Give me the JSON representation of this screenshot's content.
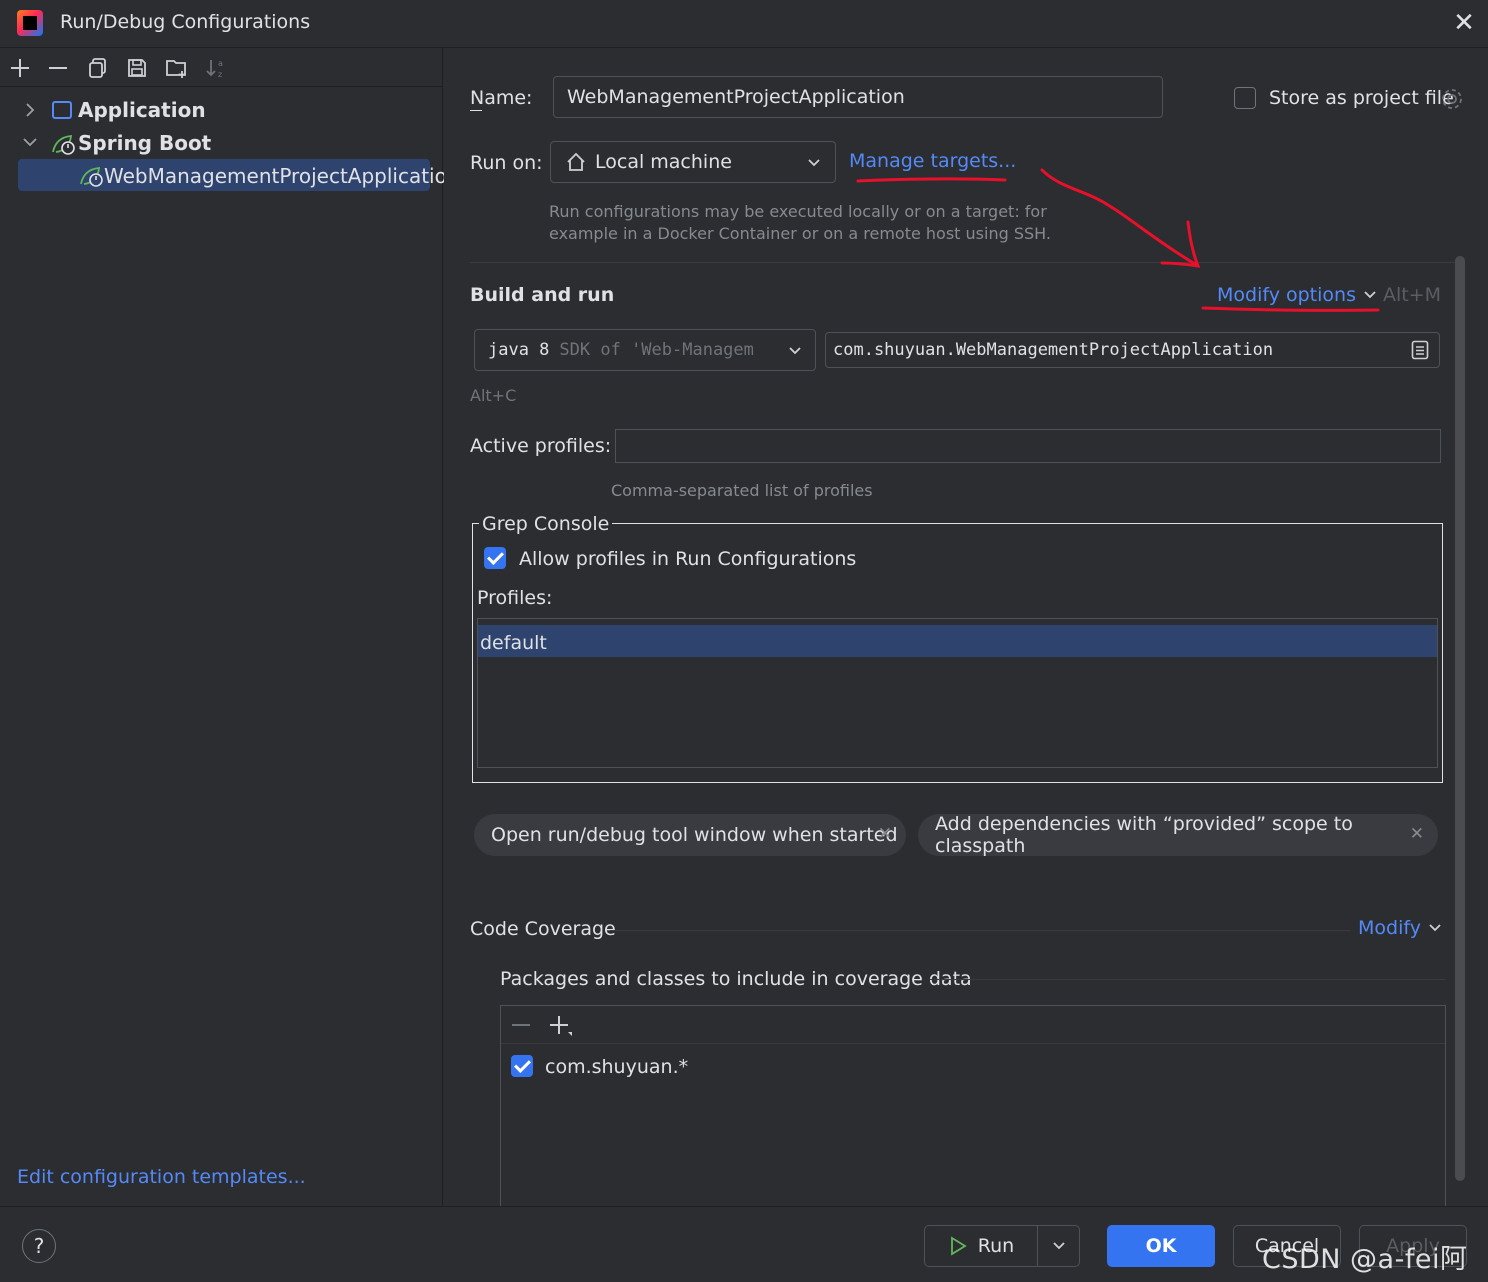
{
  "window": {
    "title": "Run/Debug Configurations",
    "close": "✕"
  },
  "toolbar": {
    "add": "+",
    "remove": "—",
    "copy": "⧉",
    "save": "💾",
    "folder": "📁",
    "sort": "↓ᵃᶻ"
  },
  "tree": {
    "application": "Application",
    "spring_boot": "Spring Boot",
    "selected": "WebManagementProjectApplication"
  },
  "edit_templates": "Edit configuration templates...",
  "form": {
    "name_label": "Name:",
    "name_value": "WebManagementProjectApplication",
    "store_label": "Store as project file",
    "run_on_label": "Run on:",
    "run_on_value": "Local machine",
    "manage_targets": "Manage targets...",
    "run_on_hint_1": "Run configurations may be executed locally or on a target: for",
    "run_on_hint_2": "example in a Docker Container or on a remote host using SSH.",
    "build_run": "Build and run",
    "modify_options": "Modify options",
    "modify_shortcut": "Alt+M",
    "sdk_java": "java 8",
    "sdk_rest": "SDK of 'Web-Managem",
    "main_class": "com.shuyuan.WebManagementProjectApplication",
    "alt_c": "Alt+C",
    "active_profiles_label": "Active profiles:",
    "active_profiles_value": "",
    "active_profiles_hint": "Comma-separated list of profiles"
  },
  "grep": {
    "title": "Grep Console",
    "allow_profiles": "Allow profiles in Run Configurations",
    "profiles_label": "Profiles:",
    "profiles": [
      "default"
    ]
  },
  "chips": [
    {
      "label": "Open run/debug tool window when started"
    },
    {
      "label": "Add dependencies with “provided” scope to classpath"
    }
  ],
  "coverage": {
    "title": "Code Coverage",
    "modify": "Modify",
    "packages_label": "Packages and classes to include in coverage data",
    "entries": [
      "com.shuyuan.*"
    ]
  },
  "buttons": {
    "help": "?",
    "run": "Run",
    "ok": "OK",
    "cancel": "Cancel",
    "apply": "Apply"
  },
  "watermark": "CSDN @a-fei阿废",
  "colors": {
    "accent": "#3574f0",
    "link": "#548af7",
    "selection": "#2e436e",
    "annotation": "#e8102a"
  }
}
